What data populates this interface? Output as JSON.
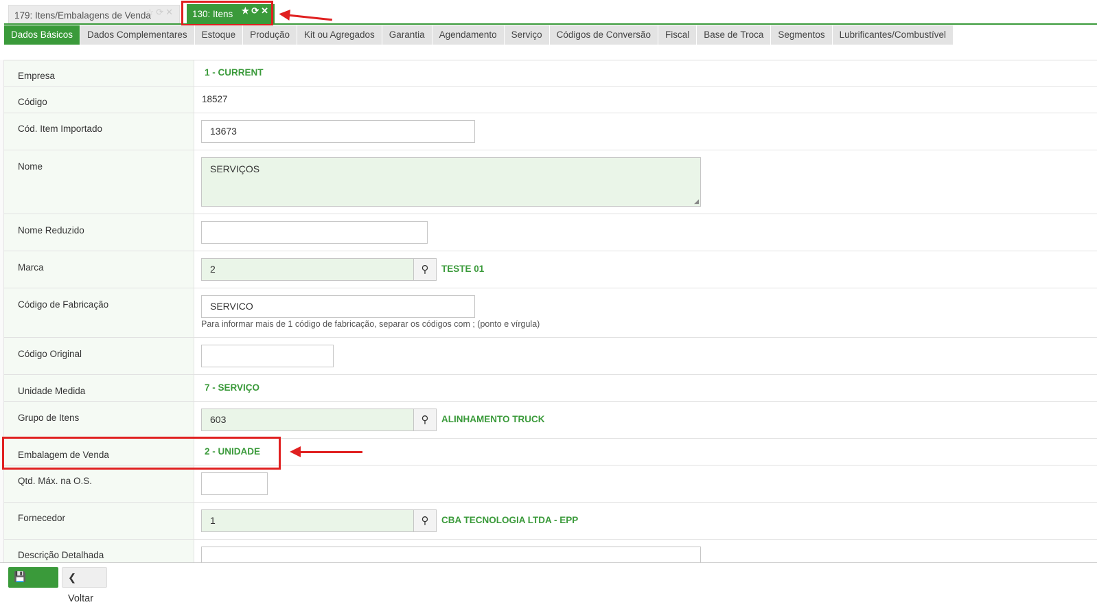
{
  "window_tabs": [
    {
      "label": "179: Itens/Embalagens de Venda",
      "icons": "☆⟳✕"
    },
    {
      "label": "130: Itens",
      "icons": "★⟳✕"
    }
  ],
  "sub_tabs": [
    "Dados Básicos",
    "Dados Complementares",
    "Estoque",
    "Produção",
    "Kit ou Agregados",
    "Garantia",
    "Agendamento",
    "Serviço",
    "Códigos de Conversão",
    "Fiscal",
    "Base de Troca",
    "Segmentos",
    "Lubrificantes/Combustível"
  ],
  "form": {
    "empresa": {
      "label": "Empresa",
      "value": "1 - CURRENT"
    },
    "codigo": {
      "label": "Código",
      "value": "18527"
    },
    "cod_item_importado": {
      "label": "Cód. Item Importado",
      "value": "13673"
    },
    "nome": {
      "label": "Nome",
      "value": "SERVIÇOS"
    },
    "nome_reduzido": {
      "label": "Nome Reduzido",
      "value": ""
    },
    "marca": {
      "label": "Marca",
      "value": "2",
      "desc": "TESTE 01"
    },
    "codigo_fabricacao": {
      "label": "Código de Fabricação",
      "value": "SERVICO",
      "hint": "Para informar mais de 1 código de fabricação, separar os códigos com ; (ponto e vírgula)"
    },
    "codigo_original": {
      "label": "Código Original",
      "value": ""
    },
    "unidade_medida": {
      "label": "Unidade Medida",
      "value": "7 - SERVIÇO"
    },
    "grupo_itens": {
      "label": "Grupo de Itens",
      "value": "603",
      "desc": "ALINHAMENTO TRUCK"
    },
    "embalagem_venda": {
      "label": "Embalagem de Venda",
      "value": "2 - UNIDADE"
    },
    "qtd_max_os": {
      "label": "Qtd. Máx. na O.S.",
      "value": ""
    },
    "fornecedor": {
      "label": "Fornecedor",
      "value": "1",
      "desc": "CBA TECNOLOGIA LTDA - EPP"
    },
    "descricao_detalhada": {
      "label": "Descrição Detalhada",
      "value": ""
    }
  },
  "footer": {
    "save_label": "Salvar",
    "back_label": "Voltar"
  },
  "colors": {
    "accent": "#3a9a3a",
    "highlight": "#e02020"
  }
}
